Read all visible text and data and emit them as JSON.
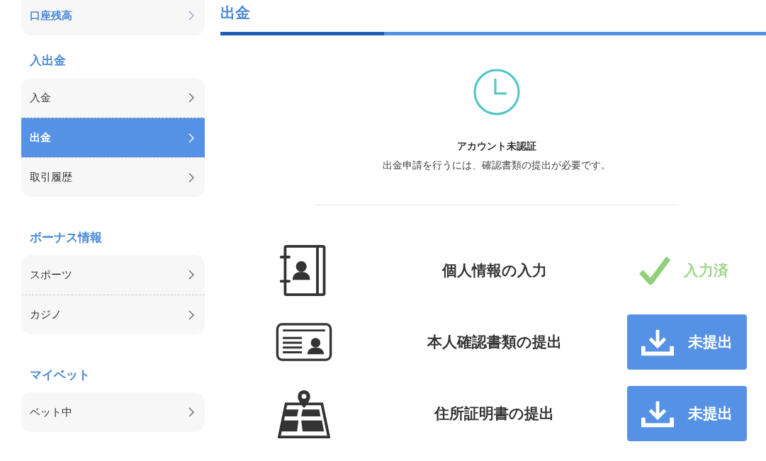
{
  "sidebar": {
    "groups": [
      {
        "items": [
          {
            "label": "口座残高",
            "kind": "accent",
            "selected": false
          }
        ]
      },
      {
        "heading": "入出金",
        "items": [
          {
            "label": "入金",
            "kind": "normal",
            "selected": false
          },
          {
            "label": "出金",
            "kind": "normal",
            "selected": true
          },
          {
            "label": "取引履歴",
            "kind": "normal",
            "selected": false
          }
        ]
      },
      {
        "heading": "ボーナス情報",
        "items": [
          {
            "label": "スポーツ",
            "kind": "normal",
            "selected": false
          },
          {
            "label": "カジノ",
            "kind": "normal",
            "selected": false
          }
        ]
      },
      {
        "heading": "マイベット",
        "items": [
          {
            "label": "ベット中",
            "kind": "normal",
            "selected": false
          }
        ]
      }
    ]
  },
  "main": {
    "title": "出金",
    "progress": {
      "level": 0.3
    },
    "notice": {
      "title": "アカウント未認証",
      "message": "出金申請を行うには、確認書類の提出が必要です。"
    },
    "steps": [
      {
        "label": "個人情報の入力",
        "kind": "done",
        "status": "入力済"
      },
      {
        "label": "本人確認書類の提出",
        "kind": "pending",
        "status": "未提出"
      },
      {
        "label": "住所証明書の提出",
        "kind": "pending",
        "status": "未提出"
      }
    ]
  }
}
